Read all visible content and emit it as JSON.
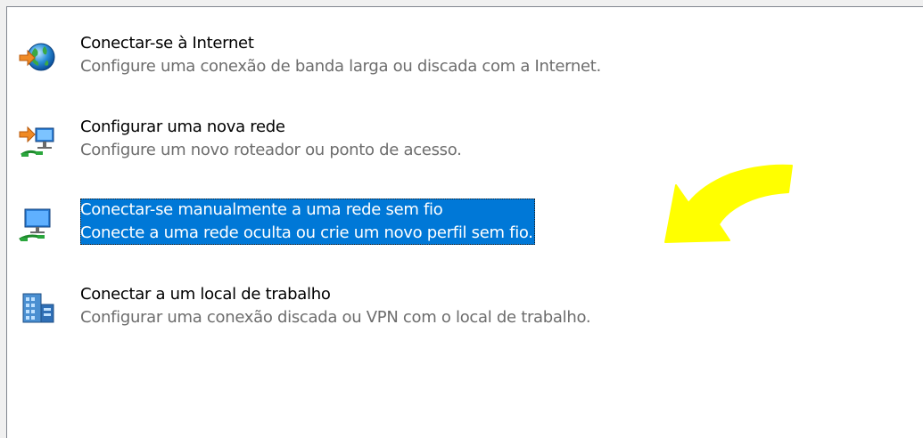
{
  "options": [
    {
      "title": "Conectar-se à Internet",
      "description": "Configure uma conexão de banda larga ou discada com a Internet.",
      "icon": "globe-connect-icon"
    },
    {
      "title": "Configurar uma nova rede",
      "description": "Configure um novo roteador ou ponto de acesso.",
      "icon": "new-network-icon"
    },
    {
      "title": "Conectar-se manualmente a uma rede sem fio",
      "description": "Conecte a uma rede oculta ou crie um novo perfil sem fio.",
      "icon": "wireless-network-icon"
    },
    {
      "title": "Conectar a um local de trabalho",
      "description": "Configurar uma conexão discada ou VPN com o local de trabalho.",
      "icon": "workplace-building-icon"
    }
  ],
  "selected_index": 2,
  "colors": {
    "selection": "#0078d7",
    "annotation_arrow": "#ffff00",
    "description_text": "#6d6d6d"
  }
}
